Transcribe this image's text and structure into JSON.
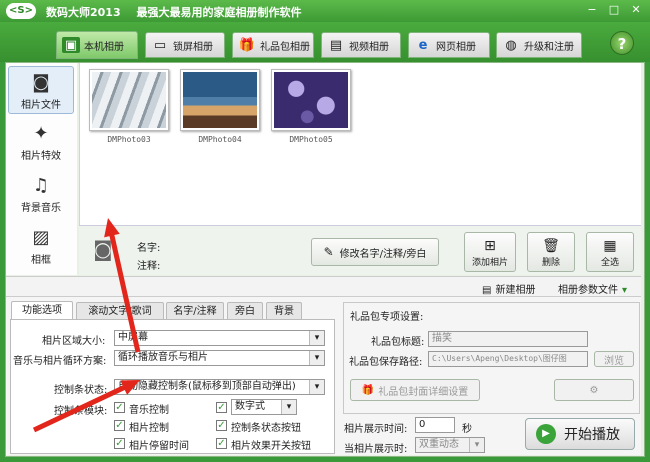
{
  "app": {
    "logo_text": "<S>",
    "name": "数码大师2013",
    "slogan": "最强大最易用的家庭相册制作软件",
    "window_buttons": [
      "−",
      "□",
      "✕"
    ]
  },
  "main_tabs": [
    {
      "label": "本机相册",
      "icon": "photo-album-icon",
      "active": true
    },
    {
      "label": "锁屏相册",
      "icon": "monitor-icon",
      "active": false
    },
    {
      "label": "礼品包相册",
      "icon": "gift-icon",
      "active": false
    },
    {
      "label": "视频相册",
      "icon": "film-icon",
      "active": false
    },
    {
      "label": "网页相册",
      "icon": "browser-icon",
      "active": false
    },
    {
      "label": "升级和注册",
      "icon": "globe-icon",
      "active": false
    }
  ],
  "help_label": "?",
  "sidebar": [
    {
      "label": "相片文件",
      "icon": "camera-icon",
      "active": true
    },
    {
      "label": "相片特效",
      "icon": "effects-icon",
      "active": false
    },
    {
      "label": "背景音乐",
      "icon": "music-note-icon",
      "active": false
    },
    {
      "label": "相框",
      "icon": "picture-frame-icon",
      "active": false
    }
  ],
  "photos": [
    {
      "name": "DMPhoto03",
      "colors": [
        "#c9d2d8",
        "#eef1f3",
        "#8d9aa3"
      ]
    },
    {
      "name": "DMPhoto04",
      "colors": [
        "#2a5a85",
        "#d7a469",
        "#5b3b26"
      ]
    },
    {
      "name": "DMPhoto05",
      "colors": [
        "#3a2a6e",
        "#b7a9e6",
        "#6a5aa6"
      ]
    }
  ],
  "info": {
    "name_label": "名字:",
    "note_label": "注释:",
    "edit_button": "修改名字/注释/旁白",
    "add_button": "添加相片",
    "delete_button": "删除",
    "select_all_button": "全选"
  },
  "project_bar": {
    "new_album": "新建相册",
    "params": "相册参数文件"
  },
  "sub_tabs": [
    "功能选项",
    "滚动文字/歌词",
    "名字/注释",
    "旁白",
    "背景"
  ],
  "options": {
    "area_size_label": "相片区域大小:",
    "area_size_value": "中屏幕",
    "loop_label": "音乐与相片循环方案:",
    "loop_value": "循环播放音乐与相片",
    "control_bar_label": "控制条状态:",
    "control_bar_value": "自动隐藏控制条(鼠标移到顶部自动弹出)",
    "control_module_label": "控制条模块:",
    "checkboxes": [
      {
        "label": "音乐控制",
        "checked": true
      },
      {
        "label": "相片控制",
        "checked": true
      },
      {
        "label": "相片停留时间",
        "checked": true
      },
      {
        "label": "控制条状态按钮",
        "checked": true
      },
      {
        "label": "相片效果开关按钮",
        "checked": true
      }
    ],
    "counter_checked": true,
    "counter_style_value": "数字式"
  },
  "gift": {
    "section_title": "礼品包专项设置:",
    "title_label": "礼品包标题:",
    "title_value": "描笑",
    "path_label": "礼品包保存路径:",
    "path_value": "C:\\Users\\Apeng\\Desktop\\图仔图",
    "browse_button": "浏览",
    "cover_button": "礼品包封面详细设置"
  },
  "timing": {
    "show_time_label": "相片展示时间:",
    "show_time_value": "0",
    "seconds_unit": "秒",
    "when_label": "当相片展示时:",
    "when_value": "双重动态"
  },
  "start_button": "开始播放",
  "colors": {
    "brand_green": "#3a9a3a",
    "arrow_red": "#e2261c"
  }
}
